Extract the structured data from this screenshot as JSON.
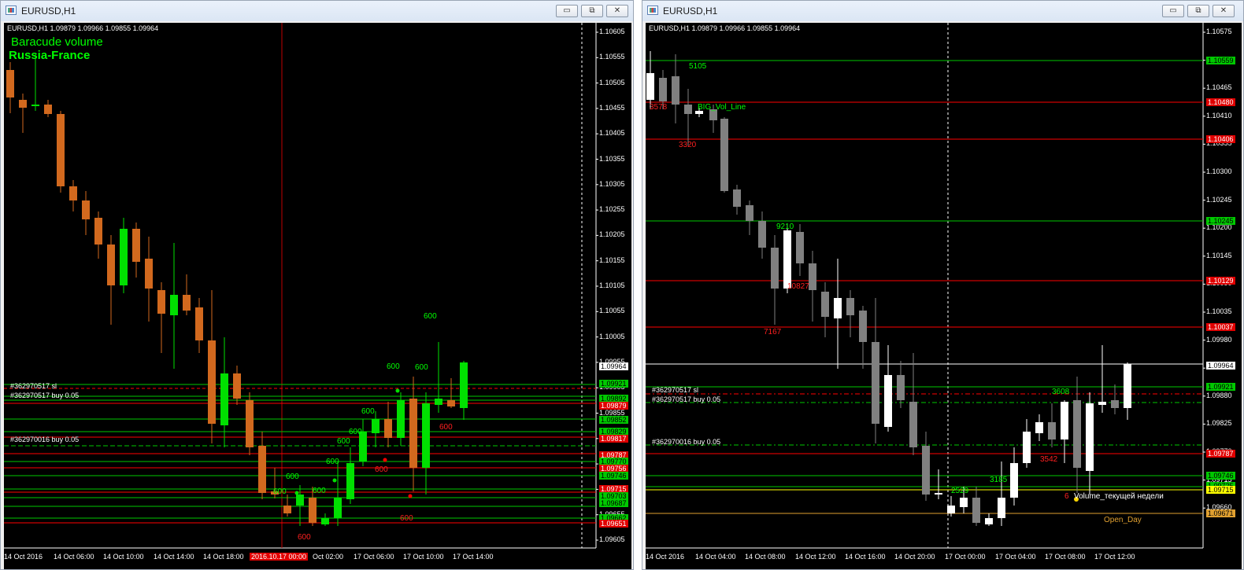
{
  "windows": [
    {
      "title": "EURUSD,H1",
      "header_info": "EURUSD,H1  1.09879 1.09966 1.09855 1.09964",
      "indicator_title": "Baracude volume",
      "indicator_subtitle": "Russia-France",
      "buttons": {
        "minimize": "▭",
        "restore": "⧉",
        "close": "✕"
      },
      "price_ticks": [
        "1.10605",
        "1.10555",
        "1.10505",
        "1.10455",
        "1.10405",
        "1.10355",
        "1.10305",
        "1.10255",
        "1.10205",
        "1.10155",
        "1.10105",
        "1.10055",
        "1.10005",
        "1.09955",
        "1.09905",
        "1.09855",
        "1.09805",
        "1.09755",
        "1.09705",
        "1.09655",
        "1.09605"
      ],
      "time_ticks": [
        "14 Oct 2016",
        "14 Oct 06:00",
        "14 Oct 10:00",
        "14 Oct 14:00",
        "14 Oct 18:00",
        "2016.10.17 00:00",
        "Oct 02:00",
        "17 Oct 06:00",
        "17 Oct 10:00",
        "17 Oct 14:00"
      ],
      "price_labels": [
        {
          "text": "1.09964",
          "color": "#ffffff",
          "bg": "#ffffff",
          "fg": "#000000"
        },
        {
          "text": "1.09921",
          "bg": "#00c800",
          "fg": "#000000"
        },
        {
          "text": "1.09892",
          "bg": "#00c800",
          "fg": "#000000"
        },
        {
          "text": "1.09879",
          "bg": "#e00000",
          "fg": "#ffffff"
        },
        {
          "text": "1.09852",
          "bg": "#00c800",
          "fg": "#000000"
        },
        {
          "text": "1.09829",
          "bg": "#00c800",
          "fg": "#000000"
        },
        {
          "text": "1.09817",
          "bg": "#e00000",
          "fg": "#ffffff"
        },
        {
          "text": "1.09787",
          "bg": "#e00000",
          "fg": "#ffffff"
        },
        {
          "text": "1.09770",
          "bg": "#00c800",
          "fg": "#000000"
        },
        {
          "text": "1.09756",
          "bg": "#e00000",
          "fg": "#ffffff"
        },
        {
          "text": "1.09746",
          "bg": "#00c800",
          "fg": "#000000"
        },
        {
          "text": "1.09725",
          "bg": "#00c800",
          "fg": "#000000"
        },
        {
          "text": "1.09715",
          "bg": "#e00000",
          "fg": "#ffffff"
        },
        {
          "text": "1.09703",
          "bg": "#00c800",
          "fg": "#000000"
        },
        {
          "text": "1.09687",
          "bg": "#00c800",
          "fg": "#000000"
        },
        {
          "text": "1.09662",
          "bg": "#00c800",
          "fg": "#000000"
        },
        {
          "text": "1.09651",
          "bg": "#e00000",
          "fg": "#ffffff"
        }
      ],
      "order_labels": [
        "#362970517 sl",
        "#362970517 buy 0.05",
        "#362970016 buy 0.05"
      ],
      "volume_labels": [
        {
          "text": "600",
          "color": "#00ff00"
        },
        {
          "text": "600",
          "color": "#00ff00"
        },
        {
          "text": "600",
          "color": "#00ff00"
        },
        {
          "text": "600",
          "color": "#00ff00"
        },
        {
          "text": "600",
          "color": "#00ff00"
        },
        {
          "text": "600",
          "color": "#00ff00"
        },
        {
          "text": "600",
          "color": "#00ff00"
        },
        {
          "text": "600",
          "color": "#00ff00"
        },
        {
          "text": "600",
          "color": "#00ff00"
        },
        {
          "text": "600",
          "color": "#00ff00"
        },
        {
          "text": "600",
          "color": "#ff2020"
        },
        {
          "text": "600",
          "color": "#ff2020"
        },
        {
          "text": "600",
          "color": "#ff2020"
        },
        {
          "text": "600",
          "color": "#ff2020"
        }
      ]
    },
    {
      "title": "EURUSD,H1",
      "header_info": "EURUSD,H1  1.09879 1.09966 1.09855 1.09964",
      "buttons": {
        "minimize": "▭",
        "restore": "⧉",
        "close": "✕"
      },
      "price_ticks": [
        "1.10575",
        "1.10520",
        "1.10465",
        "1.10410",
        "1.10355",
        "1.10300",
        "1.10245",
        "1.10200",
        "1.10145",
        "1.10090",
        "1.10035",
        "1.09980",
        "1.09925",
        "1.09880",
        "1.09825",
        "1.09770",
        "1.09715",
        "1.09660"
      ],
      "time_ticks": [
        "14 Oct 2016",
        "14 Oct 04:00",
        "14 Oct 08:00",
        "14 Oct 12:00",
        "14 Oct 16:00",
        "14 Oct 20:00",
        "17 Oct 00:00",
        "17 Oct 04:00",
        "17 Oct 08:00",
        "17 Oct 12:00"
      ],
      "price_labels": [
        {
          "text": "1.10559",
          "bg": "#00c800",
          "fg": "#000000"
        },
        {
          "text": "1.10480",
          "bg": "#e00000",
          "fg": "#ffffff"
        },
        {
          "text": "1.10406",
          "bg": "#e00000",
          "fg": "#ffffff"
        },
        {
          "text": "1.10245",
          "bg": "#00c800",
          "fg": "#000000"
        },
        {
          "text": "1.10129",
          "bg": "#e00000",
          "fg": "#ffffff"
        },
        {
          "text": "1.10037",
          "bg": "#e00000",
          "fg": "#ffffff"
        },
        {
          "text": "1.09964",
          "bg": "#ffffff",
          "fg": "#000000"
        },
        {
          "text": "1.09921",
          "bg": "#00c800",
          "fg": "#000000"
        },
        {
          "text": "1.09787",
          "bg": "#e00000",
          "fg": "#ffffff"
        },
        {
          "text": "1.09746",
          "bg": "#00c800",
          "fg": "#000000"
        },
        {
          "text": "1.09725",
          "bg": "#00c800",
          "fg": "#000000"
        },
        {
          "text": "1.09715",
          "bg": "#ffff00",
          "fg": "#000000"
        },
        {
          "text": "1.09671",
          "bg": "#e0a030",
          "fg": "#000000"
        }
      ],
      "order_labels": [
        "#362970517 sl",
        "#362970517 buy 0.05",
        "#362970016 buy 0.05"
      ],
      "annotations": [
        {
          "text": "5105",
          "color": "#00ff00"
        },
        {
          "text": "3578",
          "color": "#ff2020"
        },
        {
          "text": "BIG_Vol_Line",
          "color": "#00ff00"
        },
        {
          "text": "3320",
          "color": "#ff2020"
        },
        {
          "text": "9210",
          "color": "#00ff00"
        },
        {
          "text": "10827",
          "color": "#ff2020"
        },
        {
          "text": "7167",
          "color": "#ff2020"
        },
        {
          "text": "3608",
          "color": "#00ff00"
        },
        {
          "text": "3542",
          "color": "#ff2020"
        },
        {
          "text": "3185",
          "color": "#00ff00"
        },
        {
          "text": "2529",
          "color": "#00ff00"
        },
        {
          "text": "6",
          "color": "#ff2020"
        },
        {
          "text": "Volume_текущей недели",
          "color": "#ffffff"
        },
        {
          "text": "Open_Day",
          "color": "#e0a030"
        }
      ]
    }
  ]
}
